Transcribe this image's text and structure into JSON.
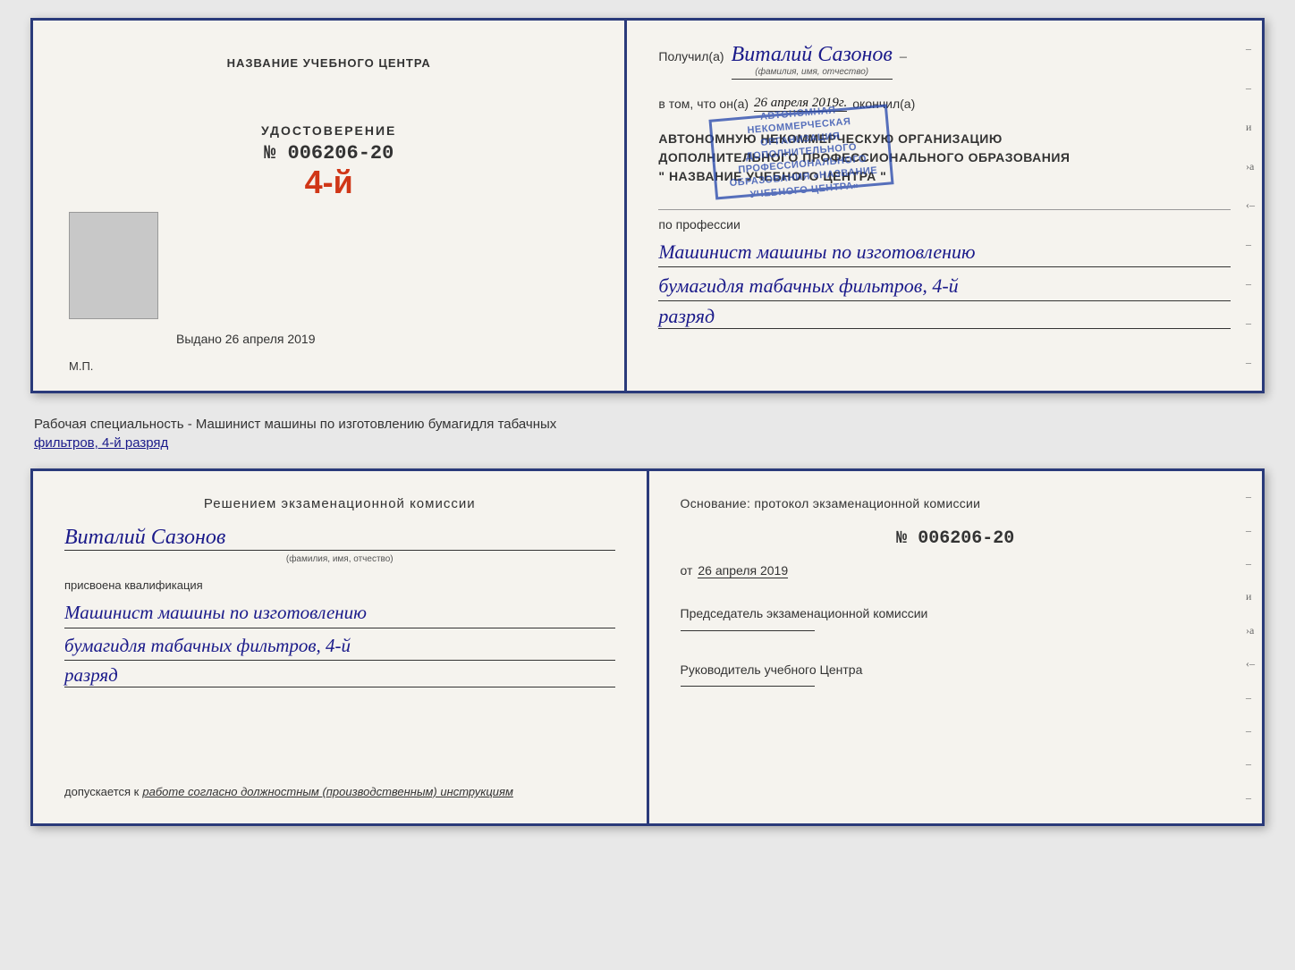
{
  "page": {
    "background": "#e8e8e8"
  },
  "top_cert": {
    "left": {
      "training_center_label": "НАЗВАНИЕ УЧЕБНОГО ЦЕНТРА",
      "udostoverenie_label": "УДОСТОВЕРЕНИЕ",
      "number_prefix": "№",
      "number": "006206-20",
      "issued_label": "Выдано",
      "issued_date": "26 апреля 2019",
      "mp_label": "М.П."
    },
    "right": {
      "poluchil_label": "Получил(а)",
      "recipient_name": "Виталий Сазонов",
      "fio_label": "(фамилия, имя, отчество)",
      "dash": "–",
      "vtom_label": "в том, что он(а)",
      "date_value": "26 апреля 2019г.",
      "okonchil_label": "окончил(а)",
      "org_line1": "АВТОНОМНУЮ НЕКОММЕРЧЕСКУЮ ОРГАНИЗАЦИЮ",
      "org_line2": "ДОПОЛНИТЕЛЬНОГО ПРОФЕССИОНАЛЬНОГО ОБРАЗОВАНИЯ",
      "org_name": "\" НАЗВАНИЕ УЧЕБНОГО ЦЕНТРА \"",
      "stamp_text": "АВТОНОМНАЯ НЕКОММЕРЧЕСКАЯ ОРГАНИЗАЦИЯ ДОПОЛНИТЕЛЬНОГО ПРОФЕССИОНАЛЬНОГО ОБРАЗОВАНИЯ «НАЗВАНИЕ УЧЕБНОГО ЦЕНТРА»",
      "po_professii_label": "по профессии",
      "profession_line1": "Машинист машины по изготовлению",
      "profession_line2": "бумагидля табачных фильтров, 4-й",
      "razryad": "разряд"
    }
  },
  "speciality_text": "Рабочая специальность - Машинист машины по изготовлению бумагидля табачных",
  "speciality_underline": "фильтров, 4-й разряд",
  "bottom_cert": {
    "left": {
      "decision_title": "Решением экзаменационной комиссии",
      "person_name": "Виталий Сазонов",
      "fio_subtitle": "(фамилия, имя, отчество)",
      "assigned_label": "присвоена квалификация",
      "profession_line1": "Машинист машины по изготовлению",
      "profession_line2": "бумагидля табачных фильтров, 4-й",
      "razryad": "разряд",
      "dopusk_label": "допускается к",
      "dopusk_value": "работе согласно должностным (производственным) инструкциям"
    },
    "right": {
      "osnование_label": "Основание: протокол экзаменационной комиссии",
      "number_prefix": "№",
      "protocol_number": "006206-20",
      "ot_label": "от",
      "ot_date": "26 апреля 2019",
      "chairman_label": "Председатель экзаменационной комиссии",
      "rukovoditel_label": "Руководитель учебного Центра"
    }
  },
  "side_dashes": [
    "–",
    "–",
    "–",
    "и",
    "›а",
    "‹–",
    "–",
    "–",
    "–",
    "–"
  ],
  "side_dashes_bottom": [
    "–",
    "–",
    "–",
    "и",
    "›а",
    "‹–",
    "–",
    "–",
    "–",
    "–"
  ]
}
